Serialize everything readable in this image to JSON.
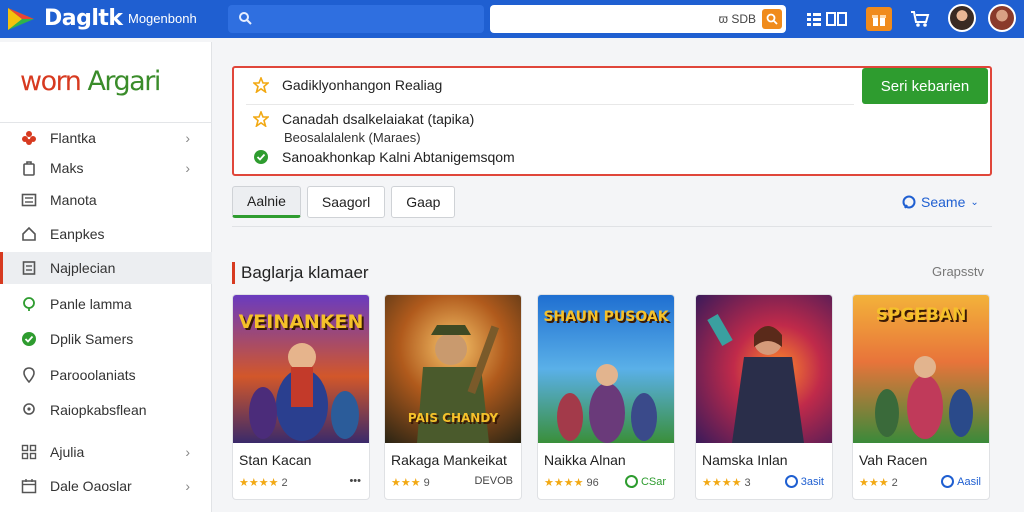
{
  "header": {
    "brand": "Dagltk",
    "subtitle": "Mogenbonh",
    "search_main_text": "ϖ SDB",
    "icons": [
      "logo-icon",
      "search-icon",
      "grid-icon",
      "gift-icon",
      "cart-icon",
      "avatar",
      "avatar"
    ]
  },
  "sidebar": {
    "logo_part1": "worn",
    "logo_part2": "Argari",
    "items": [
      {
        "label": "Flantka",
        "icon": "flower-icon",
        "has_chevron": true,
        "color": "#d73a20"
      },
      {
        "label": "Maks",
        "icon": "bag-icon",
        "has_chevron": true,
        "color": "#555555"
      },
      {
        "label": "Manota",
        "icon": "list-icon",
        "has_chevron": false,
        "color": "#555555"
      },
      {
        "label": "Eanpkes",
        "icon": "home-icon",
        "has_chevron": false,
        "color": "#555555"
      },
      {
        "label": "Najplecian",
        "icon": "doc-icon",
        "has_chevron": false,
        "color": "#555555",
        "active": true
      },
      {
        "label": "Panle lamma",
        "icon": "pin-icon",
        "has_chevron": false,
        "color": "#2e9c2f"
      },
      {
        "label": "Dplik Samers",
        "icon": "check-icon",
        "has_chevron": false,
        "color": "#2e9c2f"
      },
      {
        "label": "Parooolaniats",
        "icon": "location-icon",
        "has_chevron": false,
        "color": "#555555"
      },
      {
        "label": "Raiopkabsflean",
        "icon": "place-icon",
        "has_chevron": false,
        "color": "#555555"
      },
      {
        "label": "Ajulia",
        "icon": "grid-icon",
        "has_chevron": true,
        "color": "#555555"
      },
      {
        "label": "Dale Oaoslar",
        "icon": "calendar-icon",
        "has_chevron": true,
        "color": "#555555"
      }
    ]
  },
  "alert": {
    "line1": "Gadiklyonhangon Realiag",
    "line2": "Canadah dsalkelaiakat (tapika)",
    "line2b": "Beosalalalenk (Maraes)",
    "line3": "Sanoakhonkap Kalni Abtanigemsqom",
    "button": "Seri kebarien",
    "colors": {
      "border": "#e0463a",
      "star": "#f2a914",
      "check": "#2e9c2f",
      "button": "#2e9c2f"
    }
  },
  "tabs": [
    {
      "label": "Aalnie",
      "active": true
    },
    {
      "label": "Saagorl",
      "active": false
    },
    {
      "label": "Gaap",
      "active": false
    }
  ],
  "sort_label": "Seame",
  "section": {
    "title": "Baglarja klamaer",
    "link": "Grapsstv"
  },
  "cards": [
    {
      "art_title": "VEINANKEN",
      "art_sub": "",
      "name": "Stan Kacan",
      "stars": "★★★★",
      "rating": "2",
      "right": "•••",
      "right_style": "dots"
    },
    {
      "art_title": "PAIS CHANDY",
      "art_sub": "",
      "name": "Rakaga Mankeikat",
      "stars": "★★★",
      "rating": "9",
      "right": "DEVOB",
      "right_style": "text"
    },
    {
      "art_title": "SHAUN PUSOAK",
      "art_sub": "",
      "name": "Naikka Alnan",
      "stars": "★★★★",
      "rating": "96",
      "right": "CSar",
      "right_style": "green"
    },
    {
      "art_title": "",
      "art_sub": "",
      "name": "Namska Inlan",
      "stars": "★★★★",
      "rating": "3",
      "right": "3asit",
      "right_style": "blue"
    },
    {
      "art_title": "SPGEBAN",
      "art_sub": "",
      "name": "Vah Racen",
      "stars": "★★★",
      "rating": "2",
      "right": "Aasil",
      "right_style": "blue"
    }
  ]
}
